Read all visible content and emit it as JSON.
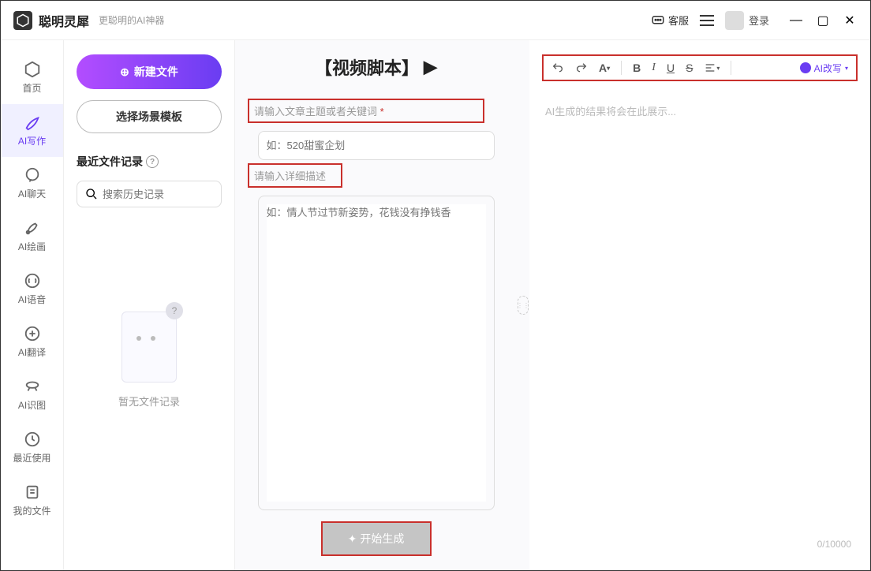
{
  "app": {
    "name": "聪明灵犀",
    "tagline": "更聪明的AI神器"
  },
  "titlebar": {
    "service": "客服",
    "login": "登录"
  },
  "sidebar": {
    "items": [
      {
        "label": "首页",
        "icon": "home"
      },
      {
        "label": "AI写作",
        "icon": "write"
      },
      {
        "label": "AI聊天",
        "icon": "chat"
      },
      {
        "label": "AI绘画",
        "icon": "paint"
      },
      {
        "label": "AI语音",
        "icon": "audio"
      },
      {
        "label": "AI翻译",
        "icon": "translate"
      },
      {
        "label": "AI识图",
        "icon": "vision"
      },
      {
        "label": "最近使用",
        "icon": "recent"
      },
      {
        "label": "我的文件",
        "icon": "files"
      }
    ]
  },
  "leftPanel": {
    "newFile": "新建文件",
    "template": "选择场景模板",
    "recentHeader": "最近文件记录",
    "searchPlaceholder": "搜索历史记录",
    "emptyText": "暂无文件记录"
  },
  "middle": {
    "title": "【视频脚本】",
    "label1": "请输入文章主题或者关键词",
    "input1Placeholder": "如：520甜蜜企划",
    "label2": "请输入详细描述",
    "input2Placeholder": "如：情人节过节新姿势，花钱没有挣钱香",
    "generateBtn": "开始生成"
  },
  "right": {
    "resultPlaceholder": "AI生成的结果将会在此展示...",
    "aiRewrite": "AI改写",
    "charCount": "0/10000"
  }
}
